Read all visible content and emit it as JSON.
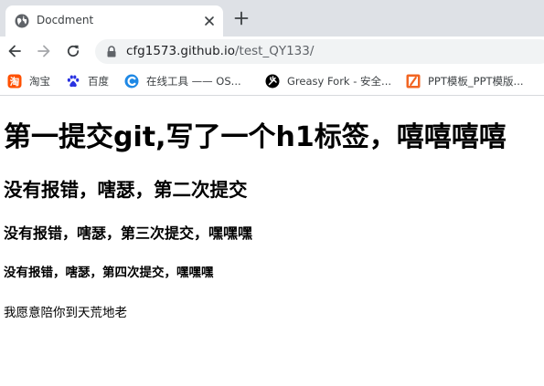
{
  "browser": {
    "tab": {
      "title": "Docdment",
      "favicon": "globe-icon"
    },
    "new_tab_icon": "plus-icon",
    "url": {
      "host": "cfg1573.github.io",
      "path": "/test_QY133/"
    },
    "bookmarks": [
      {
        "label": "淘宝",
        "icon": "taobao-icon"
      },
      {
        "label": "百度",
        "icon": "baidu-paw-icon"
      },
      {
        "label": "在线工具 —— OS...",
        "icon": "c-logo-icon"
      },
      {
        "label": "Greasy Fork - 安全...",
        "icon": "greasy-fork-icon"
      },
      {
        "label": "PPT模板_PPT模版...",
        "icon": "ppt-template-icon"
      }
    ]
  },
  "page": {
    "h1": "第一提交git,写了一个h1标签，嘻嘻嘻嘻",
    "h2": "没有报错，嗐瑟，第二次提交",
    "h3": "没有报错，嗐瑟，第三次提交，嘿嘿嘿",
    "h4": "没有报错，嗐瑟，第四次提交，嘿嘿嘿",
    "paragraph": "我愿意陪你到天荒地老"
  },
  "colors": {
    "tabstrip_bg": "#dee1e6",
    "omnibox_bg": "#f1f3f4",
    "taobao": "#ff5000",
    "baidu": "#2932e1",
    "ppt": "#f26522"
  }
}
